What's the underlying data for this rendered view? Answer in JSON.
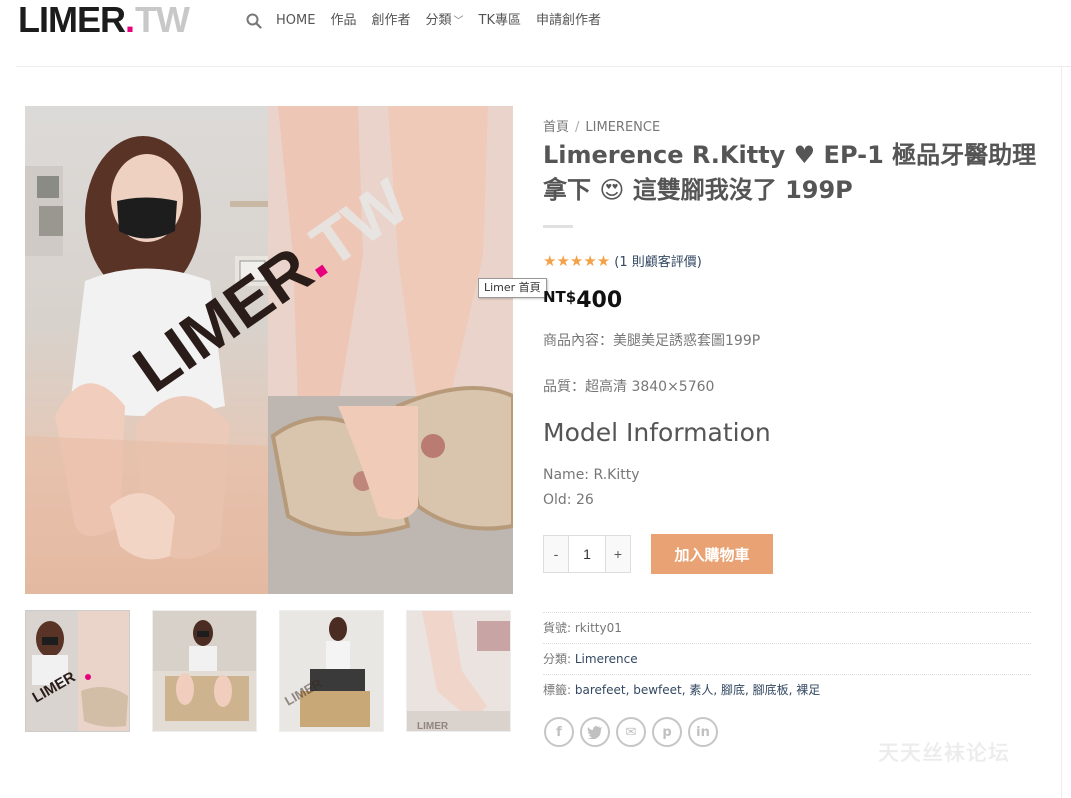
{
  "logo": {
    "main": "LIMER",
    "dot": ".",
    "suffix": "TW"
  },
  "nav": {
    "search_icon": "search-icon",
    "items": [
      "HOME",
      "作品",
      "創作者",
      "分類",
      "TK專區",
      "申請創作者"
    ]
  },
  "tooltip": "Limer 首頁",
  "watermark": {
    "main": "LIMER",
    "dot": ".",
    "suffix": "TW"
  },
  "breadcrumb": {
    "home": "首頁",
    "sep": "/",
    "category": "LIMERENCE"
  },
  "product": {
    "title": "Limerence R.Kitty ♥ EP-1 極品牙醫助理拿下 😍 這雙腳我沒了 199P",
    "stars": "★★★★★",
    "rating_value": 5,
    "review_text": "(1 則顧客評價)",
    "currency": "NT$",
    "price": "400",
    "content_line": "商品內容：美腿美足誘惑套圖199P",
    "quality_line": "品質：超高清 3840×5760",
    "model_heading": "Model Information",
    "model_name": "Name: R.Kitty",
    "model_age": "Old: 26",
    "qty_minus": "-",
    "qty_value": "1",
    "qty_plus": "+",
    "add_to_cart": "加入購物車"
  },
  "meta": {
    "sku_label": "貨號:",
    "sku_value": "rkitty01",
    "category_label": "分類:",
    "category_value": "Limerence",
    "tags_label": "標籤:",
    "tags_value": "barefeet, bewfeet, 素人, 腳底, 腳底板, 裸足"
  },
  "share": [
    "f",
    "t",
    "✉",
    "p",
    "in"
  ],
  "forum_watermark": "天天丝袜论坛",
  "colors": {
    "accent": "#e8a274",
    "brand_pink": "#e6007e",
    "link": "#334862",
    "star": "#f4a24a"
  }
}
